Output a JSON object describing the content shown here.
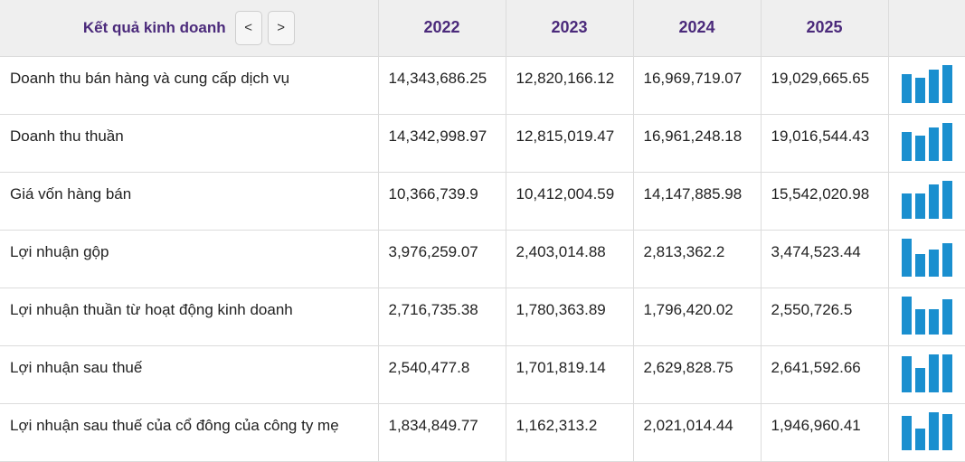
{
  "header": {
    "title": "Kết quả kinh doanh",
    "prev_label": "<",
    "next_label": ">",
    "years": [
      "2022",
      "2023",
      "2024",
      "2025"
    ]
  },
  "colors": {
    "accent": "#4b2a7b",
    "bar": "#1a8fcf"
  },
  "rows": [
    {
      "label": "Doanh thu bán hàng và cung cấp dịch vụ",
      "display": [
        "14,343,686.25",
        "12,820,166.12",
        "16,969,719.07",
        "19,029,665.65"
      ],
      "values": [
        14343686.25,
        12820166.12,
        16969719.07,
        19029665.65
      ]
    },
    {
      "label": "Doanh thu thuần",
      "display": [
        "14,342,998.97",
        "12,815,019.47",
        "16,961,248.18",
        "19,016,544.43"
      ],
      "values": [
        14342998.97,
        12815019.47,
        16961248.18,
        19016544.43
      ]
    },
    {
      "label": "Giá vốn hàng bán",
      "display": [
        "10,366,739.9",
        "10,412,004.59",
        "14,147,885.98",
        "15,542,020.98"
      ],
      "values": [
        10366739.9,
        10412004.59,
        14147885.98,
        15542020.98
      ]
    },
    {
      "label": "Lợi nhuận gộp",
      "display": [
        "3,976,259.07",
        "2,403,014.88",
        "2,813,362.2",
        "3,474,523.44"
      ],
      "values": [
        3976259.07,
        2403014.88,
        2813362.2,
        3474523.44
      ]
    },
    {
      "label": "Lợi nhuận thuần từ hoạt động kinh doanh",
      "display": [
        "2,716,735.38",
        "1,780,363.89",
        "1,796,420.02",
        "2,550,726.5"
      ],
      "values": [
        2716735.38,
        1780363.89,
        1796420.02,
        2550726.5
      ]
    },
    {
      "label": "Lợi nhuận sau thuế",
      "display": [
        "2,540,477.8",
        "1,701,819.14",
        "2,629,828.75",
        "2,641,592.66"
      ],
      "values": [
        2540477.8,
        1701819.14,
        2629828.75,
        2641592.66
      ]
    },
    {
      "label": "Lợi nhuận sau thuế của cổ đông của công ty mẹ",
      "display": [
        "1,834,849.77",
        "1,162,313.2",
        "2,021,014.44",
        "1,946,960.41"
      ],
      "values": [
        1834849.77,
        1162313.2,
        2021014.44,
        1946960.41
      ]
    }
  ]
}
